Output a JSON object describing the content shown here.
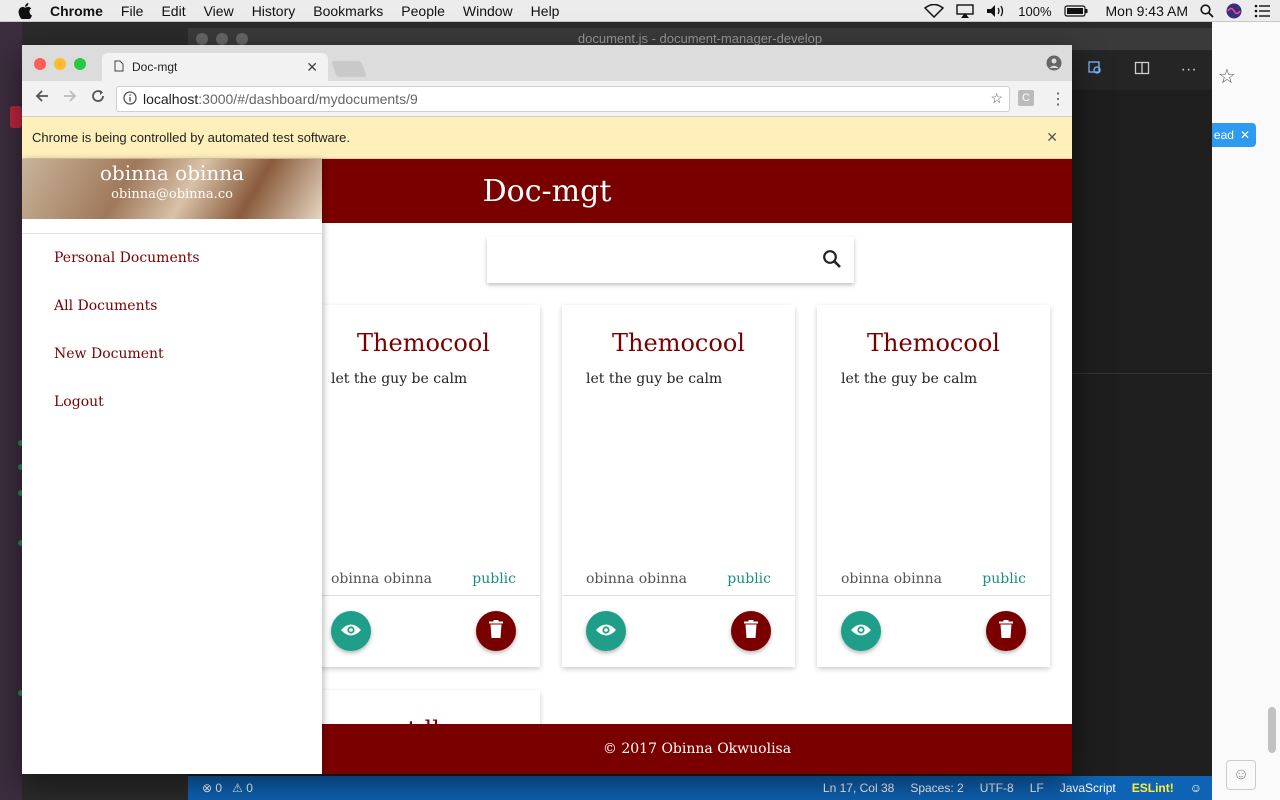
{
  "menubar": {
    "app": "Chrome",
    "items": [
      "File",
      "Edit",
      "View",
      "History",
      "Bookmarks",
      "People",
      "Window",
      "Help"
    ],
    "battery": "100%",
    "clock": "Mon 9:43 AM"
  },
  "vscode": {
    "window_title": "document.js - document-manager-develop",
    "status": {
      "errors": "0",
      "warnings": "0",
      "position": "Ln 17, Col 38",
      "spaces": "Spaces: 2",
      "encoding": "UTF-8",
      "eol": "LF",
      "language": "JavaScript",
      "linter": "ESLint!"
    }
  },
  "right_app": {
    "chip_label": "ead"
  },
  "chrome": {
    "tab_title": "Doc-mgt",
    "url_host": "localhost",
    "url_path": ":3000/#/dashboard/mydocuments/9",
    "ext_label": "C",
    "infobar_text": "Chrome is being controlled by automated test software."
  },
  "app": {
    "title": "Doc-mgt",
    "search": {
      "placeholder": ""
    },
    "user": {
      "name": "obinna obinna",
      "email": "obinna@obinna.co"
    },
    "nav": [
      "Personal Documents",
      "All Documents",
      "New Document",
      "Logout"
    ],
    "cards": [
      {
        "title": "Themocool",
        "body": "let the guy be calm",
        "owner": "obinna obinna",
        "access": "public"
      },
      {
        "title": "Themocool",
        "body": "let the guy be calm",
        "owner": "obinna obinna",
        "access": "public"
      },
      {
        "title": "Themocool",
        "body": "let the guy be calm",
        "owner": "obinna obinna",
        "access": "public"
      }
    ],
    "partial_card_title": "t ll",
    "footer": "© 2017 Obinna Okwuolisa"
  },
  "colors": {
    "brand": "#7a0000",
    "teal": "#1f9e8a",
    "infobar": "#fff0bb"
  }
}
